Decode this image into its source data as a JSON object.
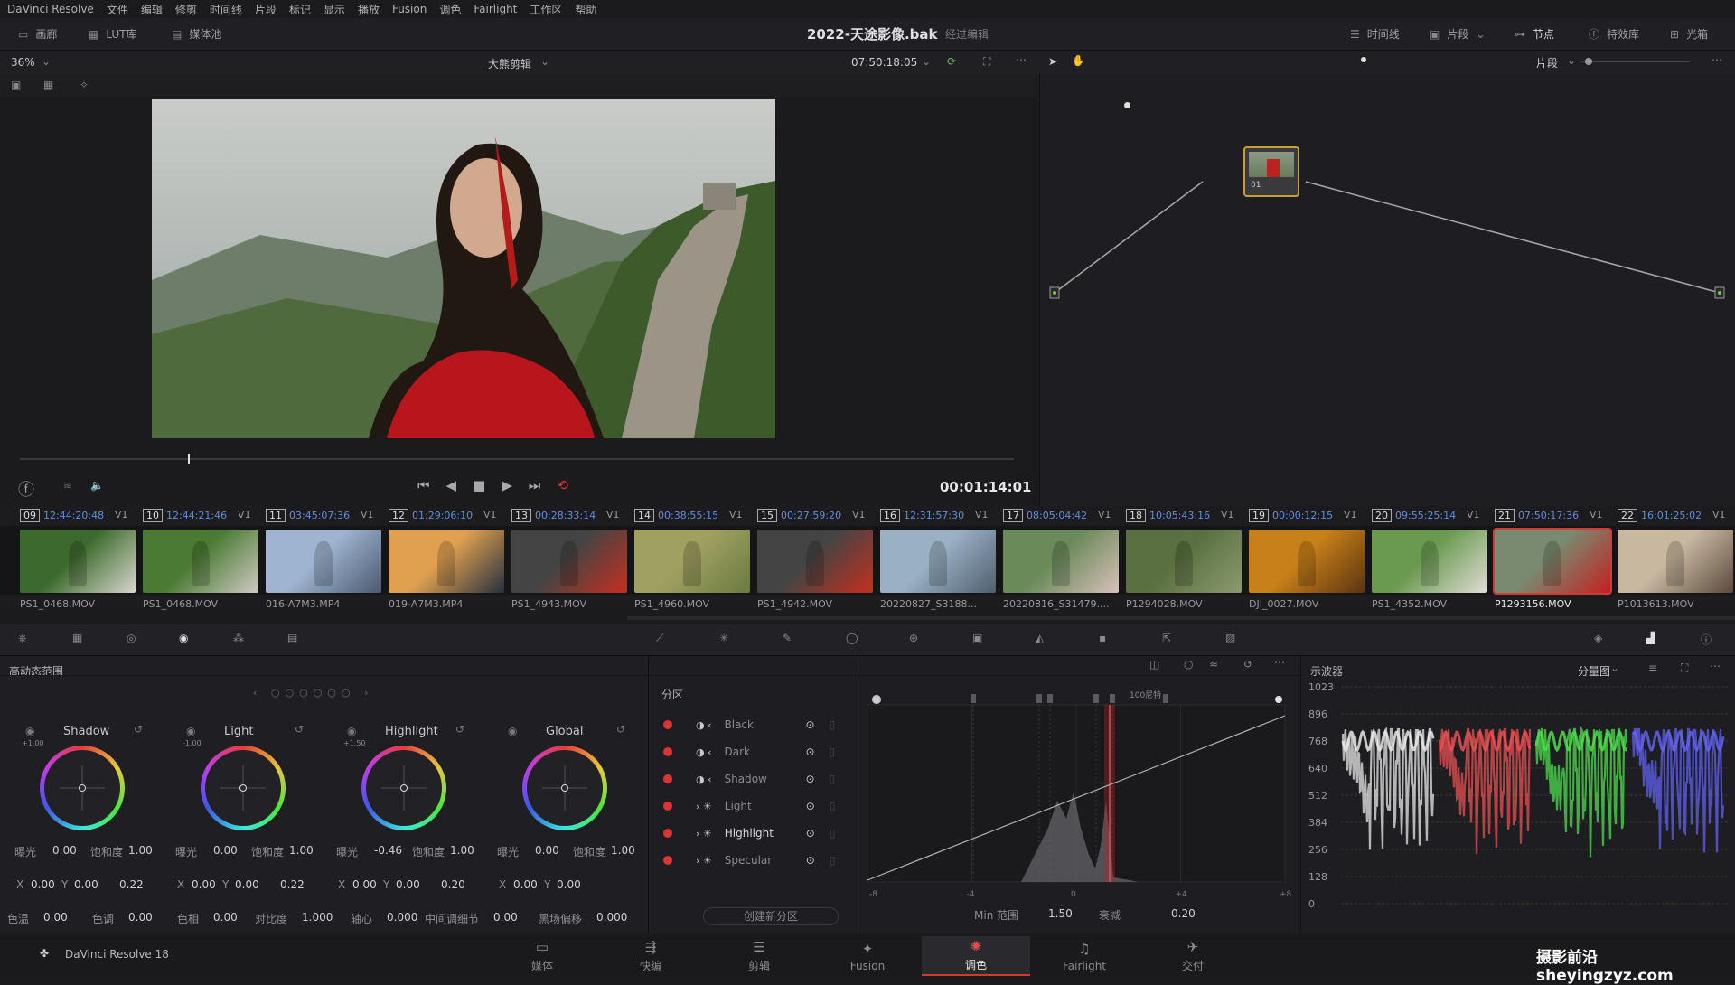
{
  "menu": [
    "DaVinci Resolve",
    "文件",
    "编辑",
    "修剪",
    "时间线",
    "片段",
    "标记",
    "显示",
    "播放",
    "Fusion",
    "调色",
    "Fairlight",
    "工作区",
    "帮助"
  ],
  "topbar": {
    "gallery": "画廊",
    "lut": "LUT库",
    "media_pool": "媒体池",
    "project_title": "2022-天途影像.bak",
    "edited": "经过编辑",
    "timeline": "时间线",
    "clips": "片段",
    "nodes": "节点",
    "effects": "特效库",
    "lightbox": "光箱"
  },
  "viewer": {
    "zoom": "36%",
    "timeline_name": "大熊剪辑",
    "timecode": "07:50:18:05",
    "playhead_tc": "00:01:14:01",
    "node_mode": "片段"
  },
  "clips": [
    {
      "n": "09",
      "tc": "12:44:20:48",
      "v": "V1",
      "name": "PS1_0468.MOV",
      "c1": "#3c6a2c",
      "c2": "#d8d6cf"
    },
    {
      "n": "10",
      "tc": "12:44:21:46",
      "v": "V1",
      "name": "PS1_0468.MOV",
      "c1": "#4a7a33",
      "c2": "#cfcac2"
    },
    {
      "n": "11",
      "tc": "03:45:07:36",
      "v": "V1",
      "name": "016-A7M3.MP4",
      "c1": "#9fb4d0",
      "c2": "#4a5a70"
    },
    {
      "n": "12",
      "tc": "01:29:06:10",
      "v": "V1",
      "name": "019-A7M3.MP4",
      "c1": "#e0a050",
      "c2": "#25303e"
    },
    {
      "n": "13",
      "tc": "00:28:33:14",
      "v": "V1",
      "name": "PS1_4943.MOV",
      "c1": "#444",
      "c2": "#c43020"
    },
    {
      "n": "14",
      "tc": "00:38:55:15",
      "v": "V1",
      "name": "PS1_4960.MOV",
      "c1": "#a0a060",
      "c2": "#6a7a40"
    },
    {
      "n": "15",
      "tc": "00:27:59:20",
      "v": "V1",
      "name": "PS1_4942.MOV",
      "c1": "#444",
      "c2": "#c43020"
    },
    {
      "n": "16",
      "tc": "12:31:57:30",
      "v": "V1",
      "name": "20220827_S3188...",
      "c1": "#9ab0c4",
      "c2": "#506070"
    },
    {
      "n": "17",
      "tc": "08:05:04:42",
      "v": "V1",
      "name": "20220816_S31479....",
      "c1": "#6a8a5a",
      "c2": "#d8c0b8"
    },
    {
      "n": "18",
      "tc": "10:05:43:16",
      "v": "V1",
      "name": "P1294028.MOV",
      "c1": "#5a7040",
      "c2": "#8a9a70"
    },
    {
      "n": "19",
      "tc": "00:00:12:15",
      "v": "V1",
      "name": "DJI_0027.MOV",
      "c1": "#c8801a",
      "c2": "#5a3410"
    },
    {
      "n": "20",
      "tc": "09:55:25:14",
      "v": "V1",
      "name": "PS1_4352.MOV",
      "c1": "#6a9a50",
      "c2": "#e0ddd6"
    },
    {
      "n": "21",
      "tc": "07:50:17:36",
      "v": "V1",
      "name": "P1293156.MOV",
      "c1": "#7a8a70",
      "c2": "#c42020"
    },
    {
      "n": "22",
      "tc": "16:01:25:02",
      "v": "V1",
      "name": "P1013613.MOV",
      "c1": "#c9b8a0",
      "c2": "#5a4a3e"
    }
  ],
  "hdr": {
    "title": "高动态范围",
    "wheels": [
      {
        "name": "Shadow",
        "exp_range": "+1.00",
        "exposure": "0.00",
        "saturation": "1.00",
        "x": "0.00",
        "y": "0.00",
        "z": "0.22"
      },
      {
        "name": "Light",
        "exp_range": "-1.00",
        "exposure": "0.00",
        "saturation": "1.00",
        "x": "0.00",
        "y": "0.00",
        "z": "0.22"
      },
      {
        "name": "Highlight",
        "exp_range": "+1.50",
        "exposure": "-0.46",
        "saturation": "1.00",
        "x": "0.00",
        "y": "0.00",
        "z": "0.20"
      },
      {
        "name": "Global",
        "exp_range": "",
        "exposure": "0.00",
        "saturation": "1.00",
        "x": "0.00",
        "y": "0.00",
        "z": ""
      }
    ],
    "labels": {
      "exposure": "曝光",
      "saturation": "饱和度"
    },
    "bottom": [
      {
        "label": "色温",
        "value": "0.00"
      },
      {
        "label": "色调",
        "value": "0.00"
      },
      {
        "label": "色相",
        "value": "0.00"
      },
      {
        "label": "对比度",
        "value": "1.000"
      },
      {
        "label": "轴心",
        "value": "0.000"
      },
      {
        "label": "中间调细节",
        "value": "0.00"
      },
      {
        "label": "黑场偏移",
        "value": "0.000"
      }
    ]
  },
  "zones": {
    "title": "分区",
    "items": [
      "Black",
      "Dark",
      "Shadow",
      "Light",
      "Highlight",
      "Specular"
    ],
    "create": "创建新分区"
  },
  "curve": {
    "min_range_label": "Min 范围",
    "min_range": "1.50",
    "falloff_label": "衰减",
    "falloff": "0.20",
    "axis": [
      "-8",
      "-4",
      "0",
      "+4",
      "+8"
    ],
    "peak_label": "100尼特"
  },
  "scope": {
    "title": "示波器",
    "mode": "分量图",
    "ticks": [
      "1023",
      "896",
      "768",
      "640",
      "512",
      "384",
      "256",
      "128",
      "0"
    ]
  },
  "bottom_nav": {
    "app": "DaVinci Resolve 18",
    "pages": [
      "媒体",
      "快编",
      "剪辑",
      "Fusion",
      "调色",
      "Fairlight",
      "交付"
    ],
    "watermark": "摄影前沿 sheyingzyz.com"
  },
  "colors": {
    "accent": "#d6382e",
    "timecode_blue": "#5b8fe0",
    "selected_clip": "#d43a3a"
  }
}
